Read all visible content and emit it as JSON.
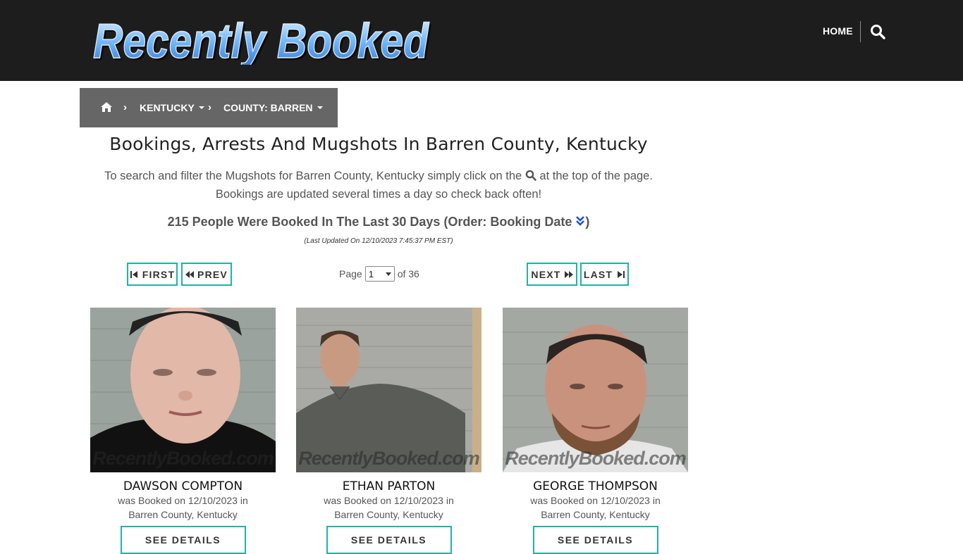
{
  "header": {
    "logo_text": "Recently Booked",
    "nav_home": "HOME",
    "search_icon": "search-icon"
  },
  "breadcrumb": {
    "home_icon": "home-icon",
    "items": [
      {
        "label": "KENTUCKY"
      },
      {
        "label": "COUNTY: BARREN"
      }
    ]
  },
  "main": {
    "title": "Bookings, Arrests And Mugshots In Barren County, Kentucky",
    "intro_part1": "To search and filter the Mugshots for Barren County, Kentucky simply click on the",
    "intro_part2": "at the top of the page.",
    "intro_line2": "Bookings are updated several times a day so check back often!",
    "count_text": "215 People Were Booked In The Last 30 Days (Order: Booking Date",
    "count_close": ")",
    "last_updated": "(Last Updated On 12/10/2023 7:45:37 PM EST)"
  },
  "pagination": {
    "first": "FIRST",
    "prev": "PREV",
    "next": "NEXT",
    "last": "LAST",
    "page_label": "Page",
    "current_page": "1",
    "of_label": "of 36"
  },
  "cards": [
    {
      "name": "DAWSON COMPTON",
      "line1": "was Booked on 12/10/2023 in",
      "line2": "Barren County, Kentucky",
      "watermark": "RecentlyBooked.com",
      "button": "SEE DETAILS"
    },
    {
      "name": "ETHAN PARTON",
      "line1": "was Booked on 12/10/2023 in",
      "line2": "Barren County, Kentucky",
      "watermark": "RecentlyBooked.com",
      "button": "SEE DETAILS"
    },
    {
      "name": "GEORGE THOMPSON",
      "line1": "was Booked on 12/10/2023 in",
      "line2": "Barren County, Kentucky",
      "watermark": "RecentlyBooked.com",
      "button": "SEE DETAILS"
    }
  ],
  "colors": {
    "header_bg": "#1d1d1d",
    "breadcrumb_bg": "#666666",
    "accent_teal": "#1fb3a8",
    "logo_blue": "#5aa8f0",
    "order_icon_blue": "#1a4fd6"
  }
}
